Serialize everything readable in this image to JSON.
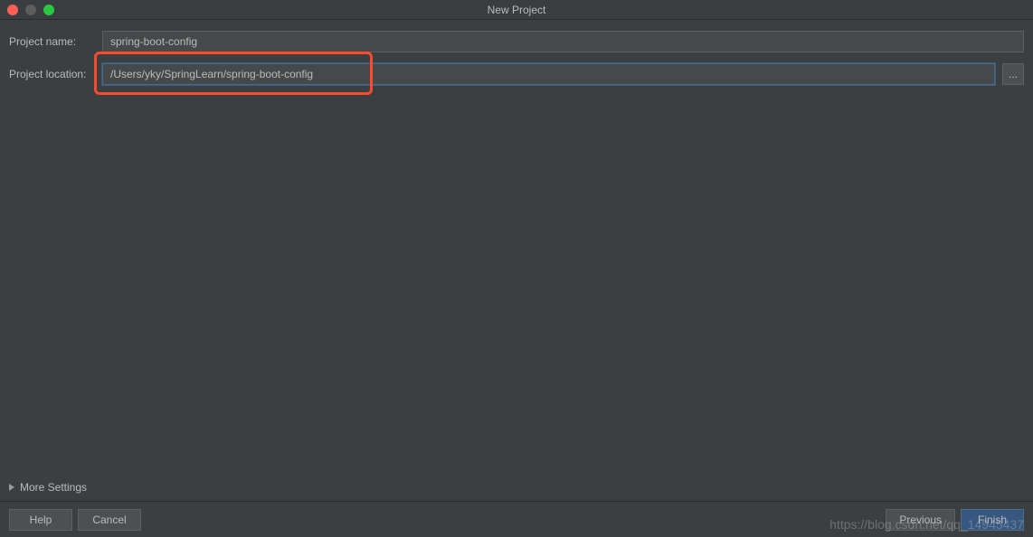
{
  "window": {
    "title": "New Project"
  },
  "form": {
    "projectNameLabel": "Project name:",
    "projectNameValue": "spring-boot-config",
    "projectLocationLabel": "Project location:",
    "projectLocationValue": "/Users/yky/SpringLearn/spring-boot-config",
    "browseLabel": "..."
  },
  "moreSettings": {
    "label": "More Settings"
  },
  "footer": {
    "help": "Help",
    "cancel": "Cancel",
    "previous": "Previous",
    "finish": "Finish"
  },
  "watermark": "https://blog.csdn.net/qq_14945437"
}
